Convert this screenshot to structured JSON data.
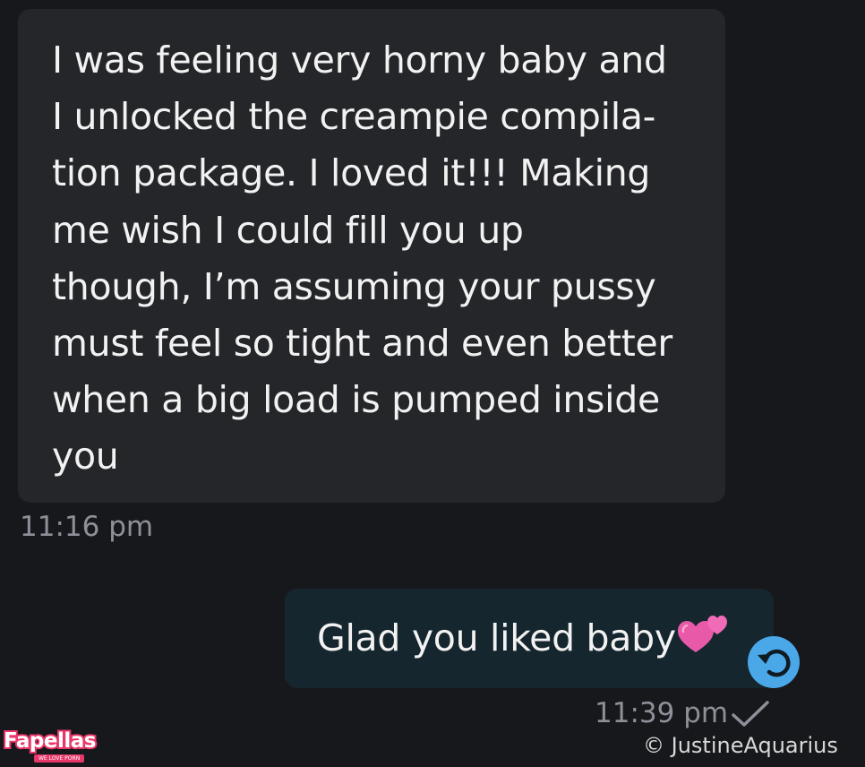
{
  "messages": {
    "incoming": {
      "text": "I was feeling very horny baby and\nI unlocked the creampie compila-\ntion package. I loved it!!! Making\nme wish I could fill you up\nthough, I’m assuming your pussy\nmust feel so tight and even better\nwhen a big load is pumped inside\nyou",
      "time": "11:16 pm"
    },
    "outgoing": {
      "text": "Glad you liked baby",
      "emoji": "two-hearts",
      "time": "11:39 pm",
      "status_icon": "single-check-icon"
    }
  },
  "reply_button": {
    "icon": "reply-arrow-icon",
    "color": "#4aa7e8"
  },
  "watermark": {
    "logo_text": "Fapellas",
    "logo_tagline": "WE LOVE PORN",
    "credit": "©  JustineAquarius"
  },
  "colors": {
    "background": "#17181b",
    "incoming_bubble": "#25262a",
    "outgoing_bubble": "#16262e",
    "timestamp": "#8e9099",
    "logo_accent": "#e8376a"
  }
}
